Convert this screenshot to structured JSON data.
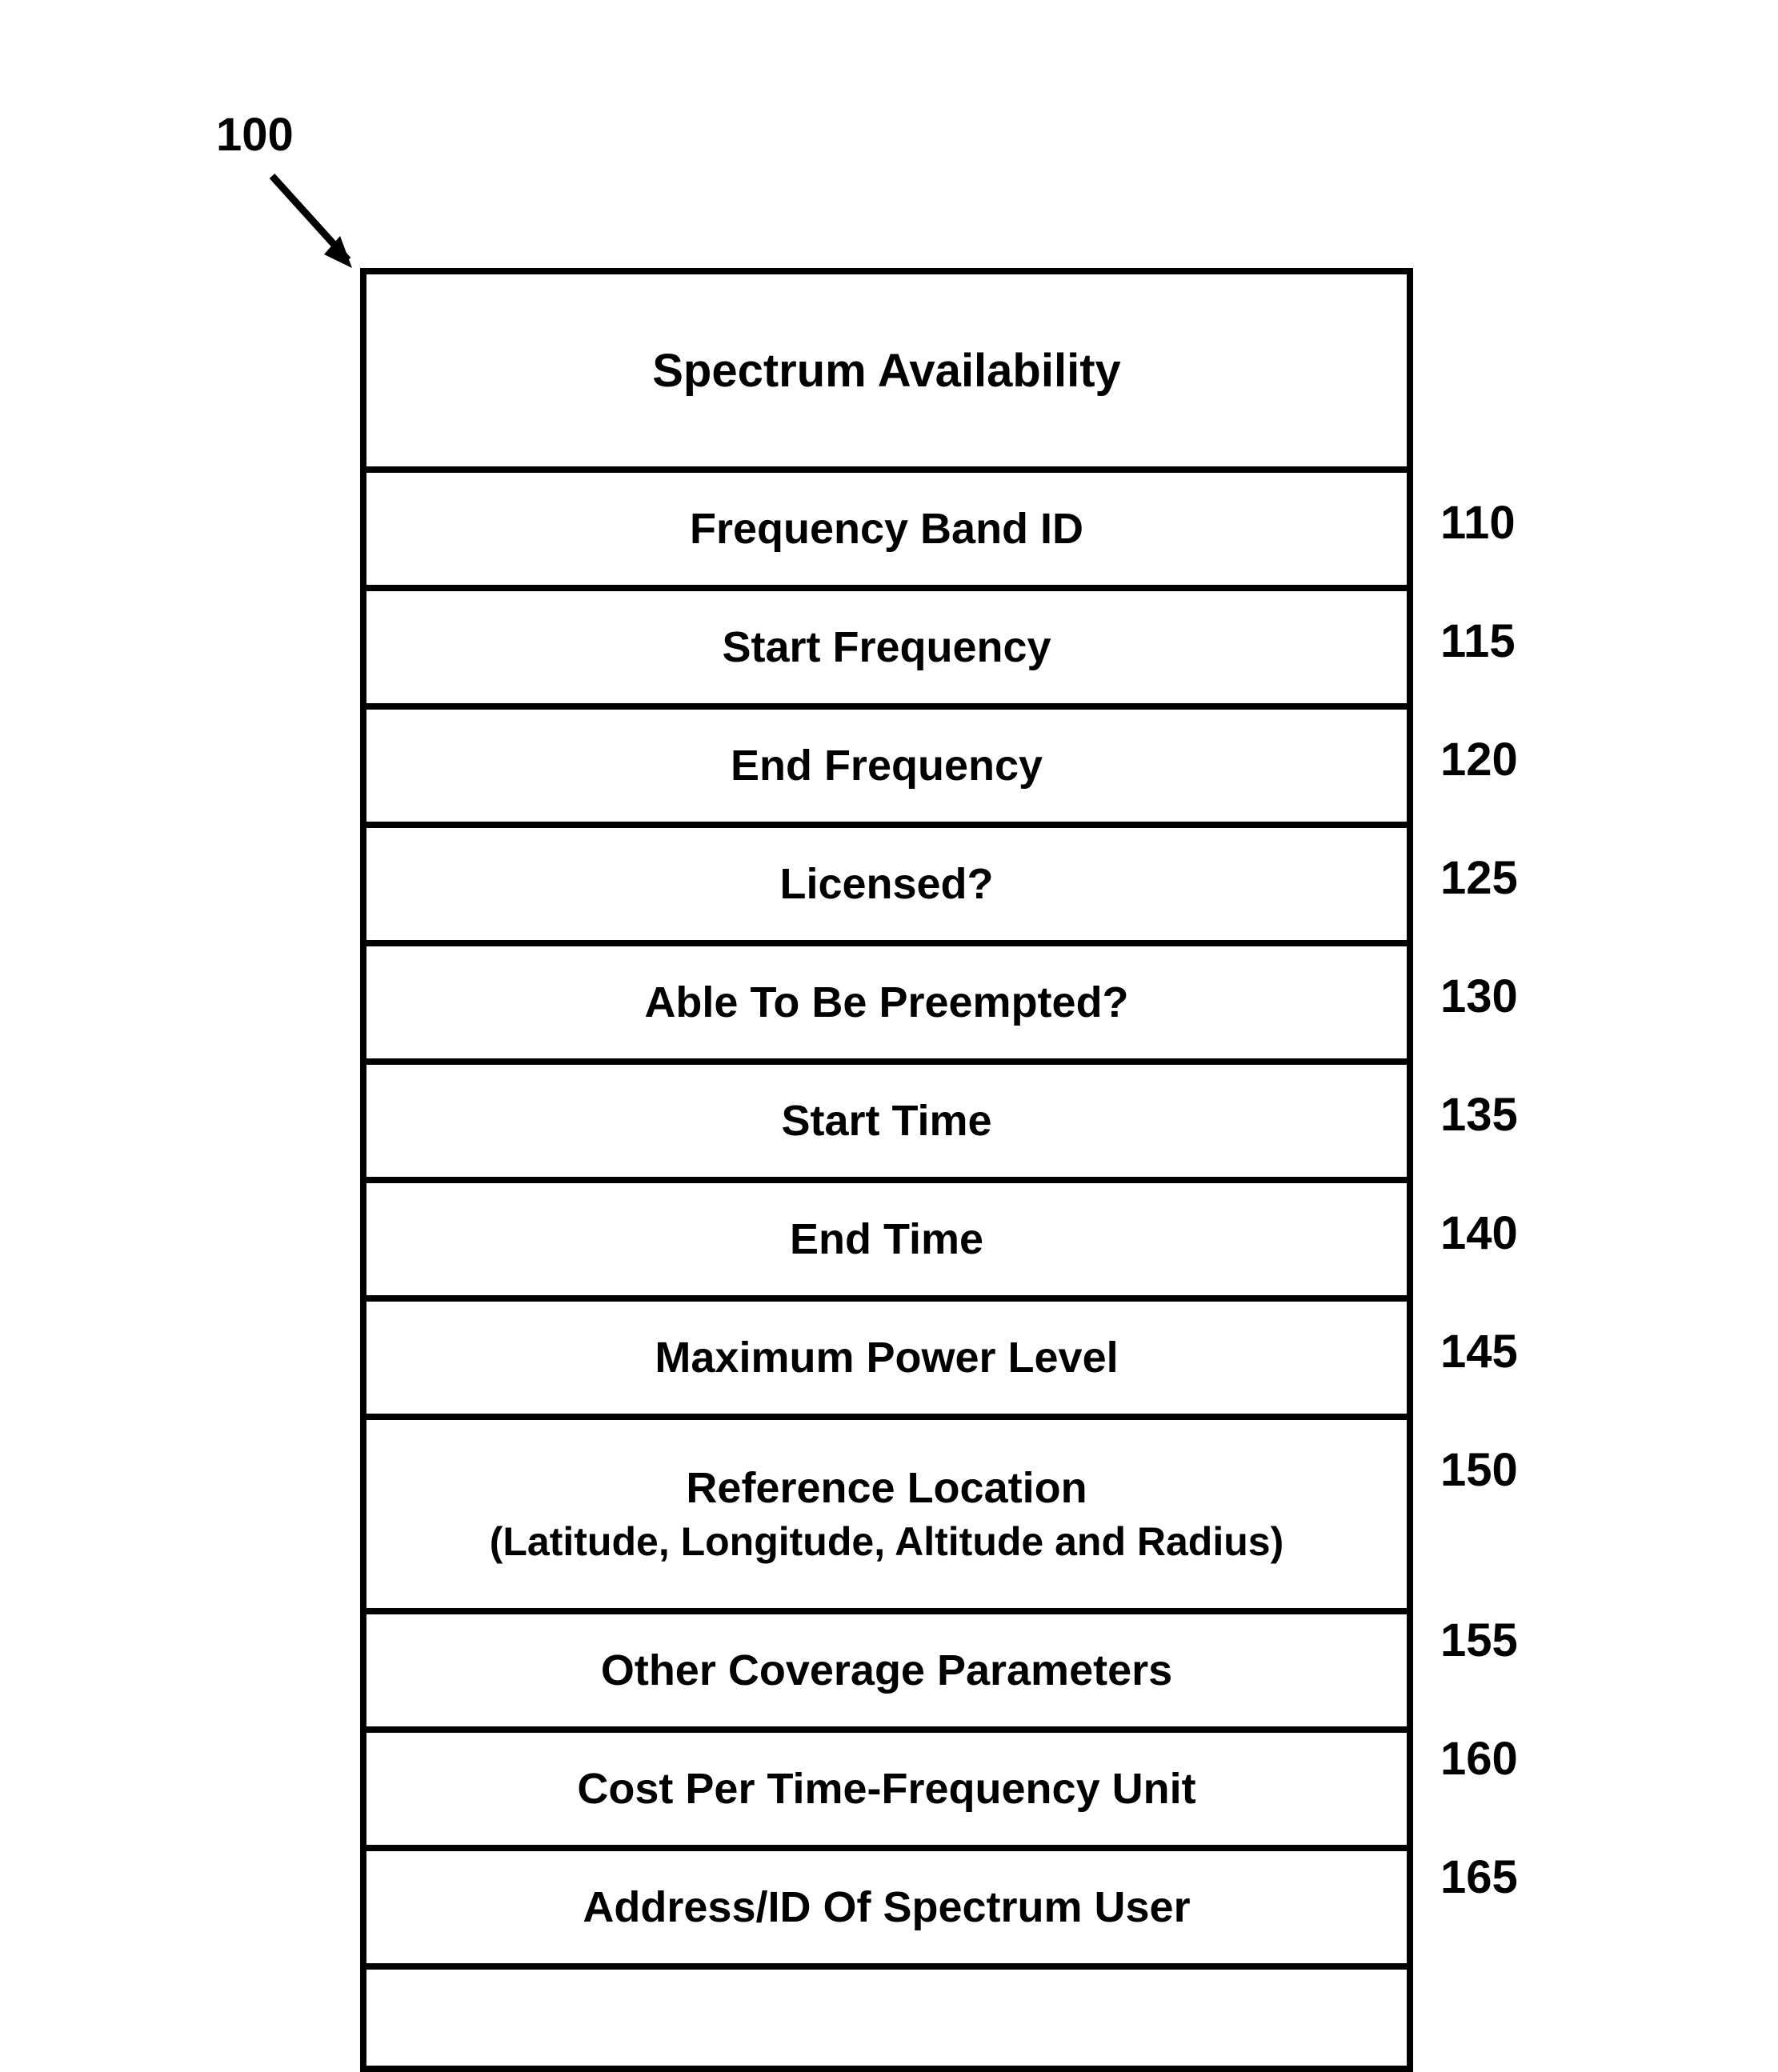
{
  "figure_number": "100",
  "header": "Spectrum Availability",
  "rows": [
    {
      "text": "Frequency Band ID",
      "label": "110"
    },
    {
      "text": "Start Frequency",
      "label": "115"
    },
    {
      "text": "End Frequency",
      "label": "120"
    },
    {
      "text": "Licensed?",
      "label": "125"
    },
    {
      "text": "Able To Be Preempted?",
      "label": "130"
    },
    {
      "text": "Start Time",
      "label": "135"
    },
    {
      "text": "End Time",
      "label": "140"
    },
    {
      "text": "Maximum Power Level",
      "label": "145"
    },
    {
      "text": "Reference Location",
      "sub": "(Latitude, Longitude, Altitude and Radius)",
      "label": "150"
    },
    {
      "text": "Other Coverage Parameters",
      "label": "155"
    },
    {
      "text": "Cost Per Time-Frequency Unit",
      "label": "160"
    },
    {
      "text": "Address/ID Of Spectrum User",
      "label": "165"
    }
  ]
}
